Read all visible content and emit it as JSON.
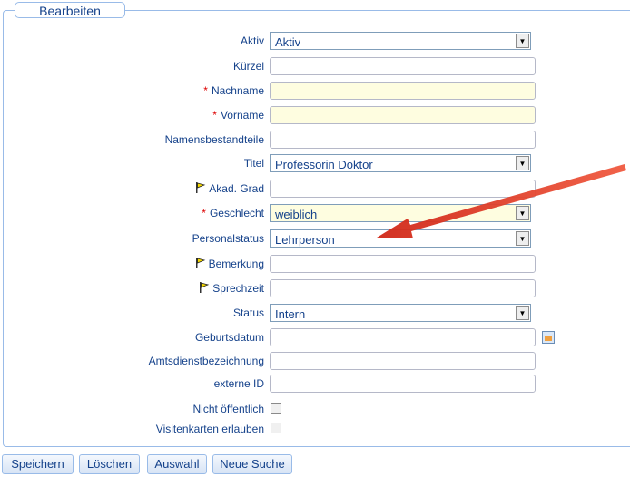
{
  "legend": "Bearbeiten",
  "fields": {
    "aktiv": {
      "label": "Aktiv",
      "value": "Aktiv"
    },
    "kuerzel": {
      "label": "Kürzel",
      "value": ""
    },
    "nachname": {
      "label": "Nachname",
      "required": "*",
      "value": ""
    },
    "vorname": {
      "label": "Vorname",
      "required": "*",
      "value": ""
    },
    "namensbestandteile": {
      "label": "Namensbestandteile",
      "value": ""
    },
    "titel": {
      "label": "Titel",
      "value": "Professorin Doktor"
    },
    "akad_grad": {
      "label": "Akad. Grad",
      "value": ""
    },
    "geschlecht": {
      "label": "Geschlecht",
      "required": "*",
      "value": "weiblich"
    },
    "personalstatus": {
      "label": "Personalstatus",
      "value": "Lehrperson"
    },
    "bemerkung": {
      "label": "Bemerkung",
      "value": ""
    },
    "sprechzeit": {
      "label": "Sprechzeit",
      "value": ""
    },
    "status": {
      "label": "Status",
      "value": "Intern"
    },
    "geburtsdatum": {
      "label": "Geburtsdatum",
      "value": ""
    },
    "amtsdienstbezeichnung": {
      "label": "Amtsdienstbezeichnung",
      "value": ""
    },
    "externe_id": {
      "label": "externe ID",
      "value": ""
    },
    "nicht_oeffentlich": {
      "label": "Nicht öffentlich",
      "checked": false
    },
    "visitenkarten": {
      "label": "Visitenkarten erlauben",
      "checked": false
    }
  },
  "buttons": {
    "save": "Speichern",
    "delete": "Löschen",
    "select": "Auswahl",
    "new_search": "Neue Suche"
  },
  "colors": {
    "label": "#15428b",
    "required": "#dd0000",
    "border": "#99bbe8",
    "required_field_bg": "#fefde0",
    "annotation_arrow": "#e03020"
  },
  "icons": {
    "flag": "flag-icon",
    "calendar": "calendar-icon",
    "dropdown": "chevron-down-icon"
  }
}
